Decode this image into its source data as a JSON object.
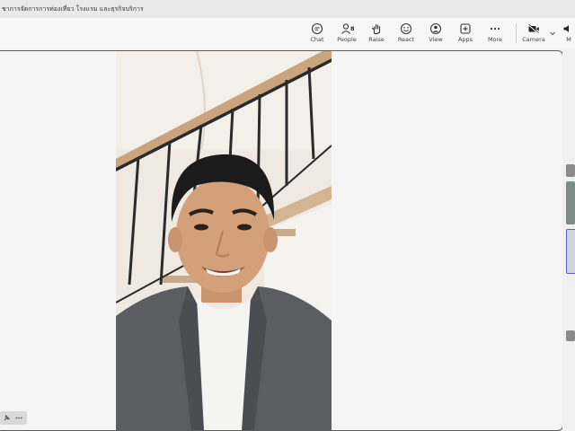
{
  "window": {
    "title": "ชาการจัดการการท่องเที่ยว โรงแรม และธุรกิจบริการ"
  },
  "toolbar": {
    "chat_label": "Chat",
    "people_label": "People",
    "people_count": "8",
    "raise_label": "Raise",
    "react_label": "React",
    "view_label": "View",
    "apps_label": "Apps",
    "more_label": "More",
    "camera_label": "Camera",
    "mic_label": "M"
  },
  "colors": {
    "accent": "#5b5fc7",
    "titlebar": "#e9e9e9",
    "stage_border": "#5c5c5c"
  },
  "icons": [
    "chat-icon",
    "people-icon",
    "raise-hand-icon",
    "react-icon",
    "view-icon",
    "apps-icon",
    "more-icon",
    "camera-icon",
    "chevron-down-icon",
    "mic-icon",
    "pin-icon",
    "ellipsis-icon"
  ]
}
